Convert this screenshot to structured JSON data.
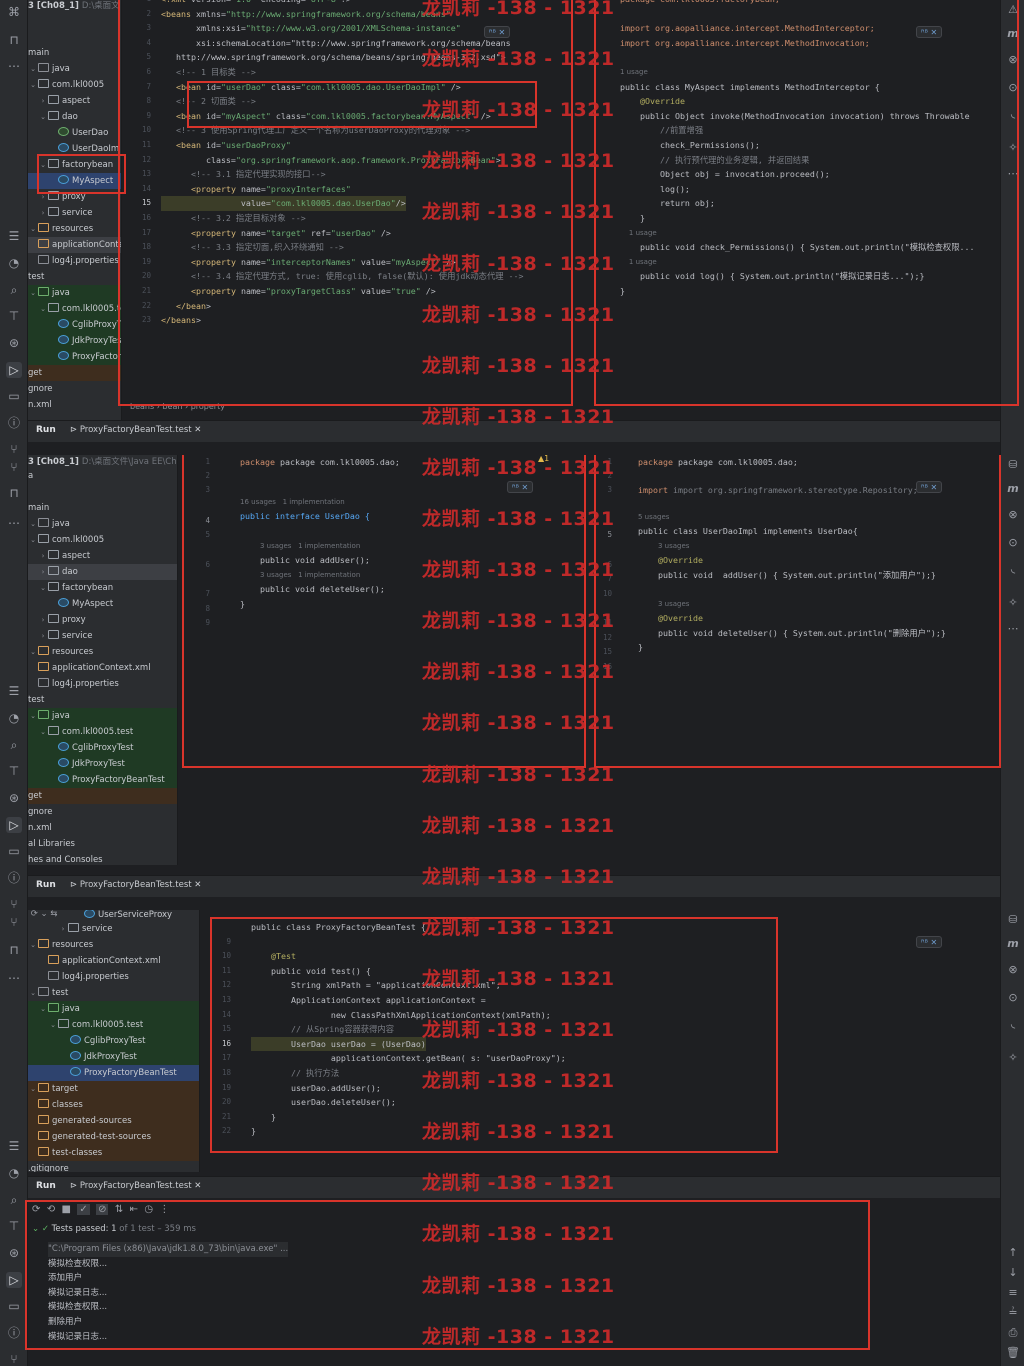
{
  "watermark": "龙凯莉 -138 - 1321",
  "p1": {
    "project_title": "3 [Ch08_1]",
    "project_path": "D:\\桌面文",
    "tree": [
      {
        "label": "main"
      },
      {
        "label": "java"
      },
      {
        "label": "com.lkl0005"
      },
      {
        "label": "aspect"
      },
      {
        "label": "dao"
      },
      {
        "label": "UserDao"
      },
      {
        "label": "UserDaoIm"
      },
      {
        "label": "factorybean"
      },
      {
        "label": "MyAspect"
      },
      {
        "label": "proxy"
      },
      {
        "label": "service"
      },
      {
        "label": "resources"
      },
      {
        "label": "applicationConte"
      },
      {
        "label": "log4j.properties"
      },
      {
        "label": "test"
      },
      {
        "label": "java"
      },
      {
        "label": "com.lkl0005.tes"
      },
      {
        "label": "CglibProxyTes"
      },
      {
        "label": "JdkProxyTest"
      },
      {
        "label": "ProxyFactoryB"
      },
      {
        "label": "get"
      },
      {
        "label": "gnore"
      },
      {
        "label": "n.xml"
      }
    ],
    "xml_lines": [
      "<?xml version=\"1.0\" encoding=\"UTF-8\"?>",
      "<beans xmlns=\"http://www.springframework.org/schema/beans\"",
      "       xmlns:xsi=\"http://www.w3.org/2001/XMLSchema-instance\"",
      "       xsi:schemaLocation=\"http://www.springframework.org/schema/beans",
      "   http://www.springframework.org/schema/beans/spring-beans-3.2.xsd\">",
      "   <!-- 1 目标类 -->",
      "   <bean id=\"userDao\" class=\"com.lkl0005.dao.UserDaoImpl\" />",
      "   <!-- 2 切面类 -->",
      "   <bean id=\"myAspect\" class=\"com.lkl0005.factorybean.MyAspect\" />",
      "   <!-- 3 使用Spring代理工厂定义一个名称为userDaoProxy的代理对象 -->",
      "   <bean id=\"userDaoProxy\"",
      "         class=\"org.springframework.aop.framework.ProxyFactoryBean\">",
      "      <!-- 3.1 指定代理实现的接口-->",
      "      <property name=\"proxyInterfaces\"",
      "                value=\"com.lkl0005.dao.UserDao\"/>",
      "      <!-- 3.2 指定目标对象 -->",
      "      <property name=\"target\" ref=\"userDao\" />",
      "      <!-- 3.3 指定切面,织入环绕通知 -->",
      "      <property name=\"interceptorNames\" value=\"myAspect\" />",
      "      <!-- 3.4 指定代理方式, true: 使用cglib, false(默认): 使用jdk动态代理 -->",
      "      <property name=\"proxyTargetClass\" value=\"true\" />",
      "   </bean>",
      "</beans>"
    ],
    "xml_numbers": [
      "1",
      "2",
      "3",
      "4",
      "5",
      "6",
      "7",
      "8",
      "9",
      "10",
      "11",
      "12",
      "13",
      "14",
      "15",
      "16",
      "17",
      "18",
      "19",
      "20",
      "21",
      "22",
      "23"
    ],
    "breadcrumb": [
      "beans",
      "bean",
      "property"
    ],
    "java_lines": [
      "package com.lkl0005.factorybean;",
      "",
      "import org.aopalliance.intercept.MethodInterceptor;",
      "import org.aopalliance.intercept.MethodInvocation;",
      "",
      "1 usage",
      "public class MyAspect implements MethodInterceptor {",
      "    @Override",
      "    public Object invoke(MethodInvocation invocation) throws Throwable",
      "        //前置增强",
      "        check_Permissions();",
      "        // 执行预代理的业务逻辑, 并返回结果",
      "        Object obj = invocation.proceed();",
      "        log();",
      "        return obj;",
      "    }",
      "    1 usage",
      "    public void check_Permissions() { System.out.println(\"模拟检查权限...",
      "    1 usage",
      "    public void log() { System.out.println(\"模拟记录日志...\");}",
      "}"
    ],
    "run_label": "Run",
    "run_tab": "ProxyFactoryBeanTest.test"
  },
  "p2": {
    "project_title": "3 [Ch08_1]",
    "project_path": "D:\\桌面文件\\Java EE\\Ch",
    "tree": [
      {
        "label": "a"
      },
      {
        "label": "main"
      },
      {
        "label": "java"
      },
      {
        "label": "com.lkl0005"
      },
      {
        "label": "aspect"
      },
      {
        "label": "dao"
      },
      {
        "label": "factorybean"
      },
      {
        "label": "MyAspect"
      },
      {
        "label": "proxy"
      },
      {
        "label": "service"
      },
      {
        "label": "resources"
      },
      {
        "label": "applicationContext.xml"
      },
      {
        "label": "log4j.properties"
      },
      {
        "label": "test"
      },
      {
        "label": "java"
      },
      {
        "label": "com.lkl0005.test"
      },
      {
        "label": "CglibProxyTest"
      },
      {
        "label": "JdkProxyTest"
      },
      {
        "label": "ProxyFactoryBeanTest"
      },
      {
        "label": "get"
      },
      {
        "label": "gnore"
      },
      {
        "label": "n.xml"
      },
      {
        "label": "al Libraries"
      },
      {
        "label": "hes and Consoles"
      }
    ],
    "left_code": {
      "l1": "package com.lkl0005.dao;",
      "usage1": "16 usages   1 implementation",
      "l4": "public interface UserDao {",
      "usage2": "3 usages   1 implementation",
      "l6": "    public void addUser();",
      "usage3": "3 usages   1 implementation",
      "l7": "    public void deleteUser();",
      "l8": "}"
    },
    "right_code": {
      "l1": "package com.lkl0005.dao;",
      "l3": "import org.springframework.stereotype.Repository;",
      "usage1": "5 usages",
      "l5": "public class UserDaoImpl implements UserDao{",
      "usage2": "3 usages",
      "l6": "    @Override",
      "l7": "    public void  addUser() { System.out.println(\"添加用户\");}",
      "usage3": "3 usages",
      "l11": "    @Override",
      "l12": "    public void deleteUser() { System.out.println(\"删除用户\");}",
      "l13": "}"
    },
    "warn": "▲1",
    "run_label": "Run",
    "run_tab": "ProxyFactoryBeanTest.test"
  },
  "p3": {
    "tree": [
      {
        "label": "UserServiceProxy"
      },
      {
        "label": "service"
      },
      {
        "label": "resources"
      },
      {
        "label": "applicationContext.xml"
      },
      {
        "label": "log4j.properties"
      },
      {
        "label": "test"
      },
      {
        "label": "java"
      },
      {
        "label": "com.lkl0005.test"
      },
      {
        "label": "CglibProxyTest"
      },
      {
        "label": "JdkProxyTest"
      },
      {
        "label": "ProxyFactoryBeanTest"
      },
      {
        "label": "target"
      },
      {
        "label": "classes"
      },
      {
        "label": "generated-sources"
      },
      {
        "label": "generated-test-sources"
      },
      {
        "label": "test-classes"
      },
      {
        "label": ".gitignore"
      }
    ],
    "code": [
      "public class ProxyFactoryBeanTest {",
      "",
      "    @Test",
      "    public void test() {",
      "        String xmlPath = \"applicationContext.xml\";",
      "        ApplicationContext applicationContext =",
      "                new ClassPathXmlApplicationContext(xmlPath);",
      "        // 从Spring容器获得内容",
      "        UserDao userDao = (UserDao)",
      "                applicationContext.getBean( s: \"userDaoProxy\");",
      "        // 执行方法",
      "        userDao.addUser();",
      "        userDao.deleteUser();",
      "    }",
      "}"
    ],
    "code_numbers": [
      "9",
      "10",
      "11",
      "12",
      "13",
      "14",
      "15",
      "16",
      "17",
      "18",
      "19",
      "20",
      "21",
      "22"
    ],
    "run_label": "Run",
    "run_tab": "ProxyFactoryBeanTest.test",
    "tests_passed": "Tests passed: 1",
    "tests_detail": "of 1 test – 359 ms",
    "console": [
      "\"C:\\Program Files (x86)\\Java\\jdk1.8.0_73\\bin\\java.exe\" ...",
      "模拟检查权限...",
      "添加用户",
      "模拟记录日志...",
      "模拟检查权限...",
      "删除用户",
      "模拟记录日志..."
    ]
  }
}
